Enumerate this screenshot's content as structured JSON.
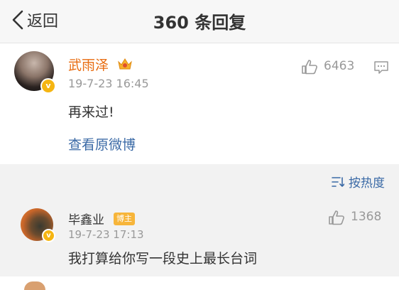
{
  "header": {
    "back_label": "返回",
    "title": "360 条回复"
  },
  "main_post": {
    "username": "武雨泽",
    "timestamp": "19-7-23 16:45",
    "like_count": "6463",
    "content": "再来过!",
    "view_original_label": "查看原微博"
  },
  "sort": {
    "label": "按热度"
  },
  "reply": {
    "username": "毕鑫业",
    "badge": "博主",
    "timestamp": "19-7-23 17:13",
    "like_count": "1368",
    "content": "我打算给你写一段史上最长台词"
  },
  "colors": {
    "username_main": "#e86b0f",
    "link": "#3b6aa6",
    "muted": "#999999",
    "verified_badge": "#f5b512",
    "poster_badge": "#f7b53a"
  }
}
